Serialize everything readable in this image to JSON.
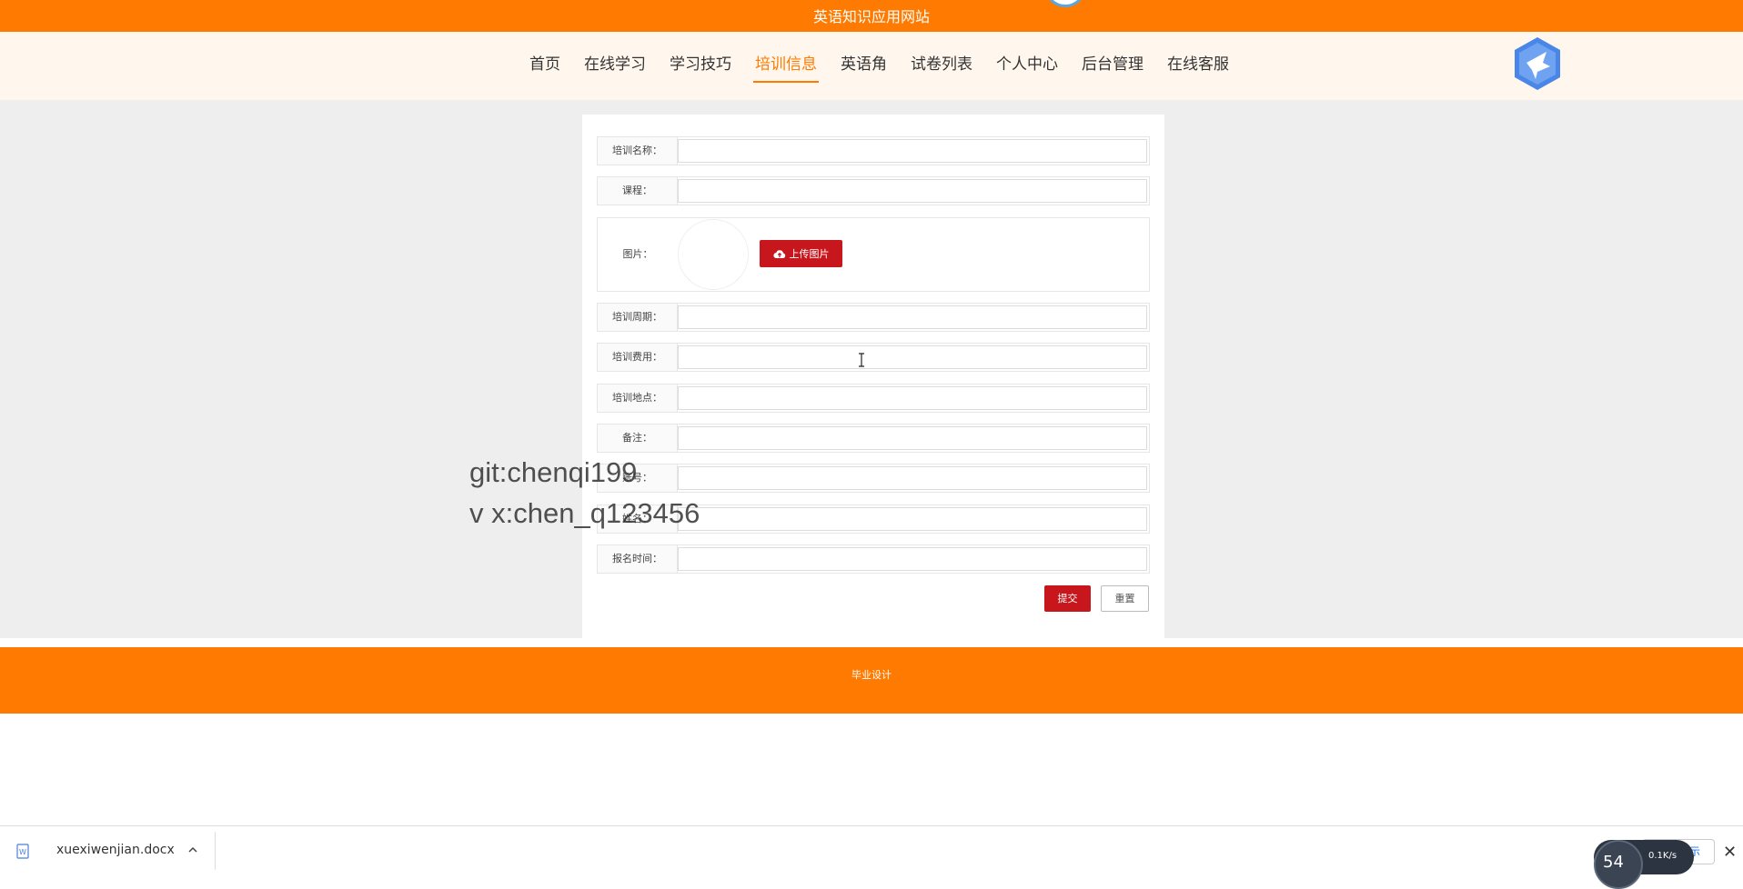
{
  "header": {
    "site_title": "英语知识应用网站"
  },
  "nav": {
    "items": [
      {
        "label": "首页"
      },
      {
        "label": "在线学习"
      },
      {
        "label": "学习技巧"
      },
      {
        "label": "培训信息",
        "active": true
      },
      {
        "label": "英语角"
      },
      {
        "label": "试卷列表"
      },
      {
        "label": "个人中心"
      },
      {
        "label": "后台管理"
      },
      {
        "label": "在线客服"
      }
    ]
  },
  "form": {
    "fields": [
      {
        "label": "培训名称：",
        "value": ""
      },
      {
        "label": "课程：",
        "value": ""
      },
      {
        "label": "培训周期：",
        "value": ""
      },
      {
        "label": "培训费用：",
        "value": ""
      },
      {
        "label": "培训地点：",
        "value": ""
      },
      {
        "label": "备注：",
        "value": ""
      },
      {
        "label": "账号：",
        "value": ""
      },
      {
        "label": "姓名：",
        "value": ""
      },
      {
        "label": "报名时间：",
        "value": ""
      }
    ],
    "image_label": "图片：",
    "upload_label": "上传图片",
    "submit_label": "提交",
    "reset_label": "重置"
  },
  "watermark": {
    "line1": "git:chenqi199",
    "line2": "v x:chen_q123456"
  },
  "footer": {
    "text": "毕业设计"
  },
  "download_bar": {
    "file_name": "xuexiwenjian.docx",
    "show_all": "全部显示",
    "close": "✕",
    "speed_pct": "54",
    "speed_rate": "0.1K/s"
  },
  "colors": {
    "brand_orange": "#ff7a00",
    "button_red": "#c8161d"
  }
}
